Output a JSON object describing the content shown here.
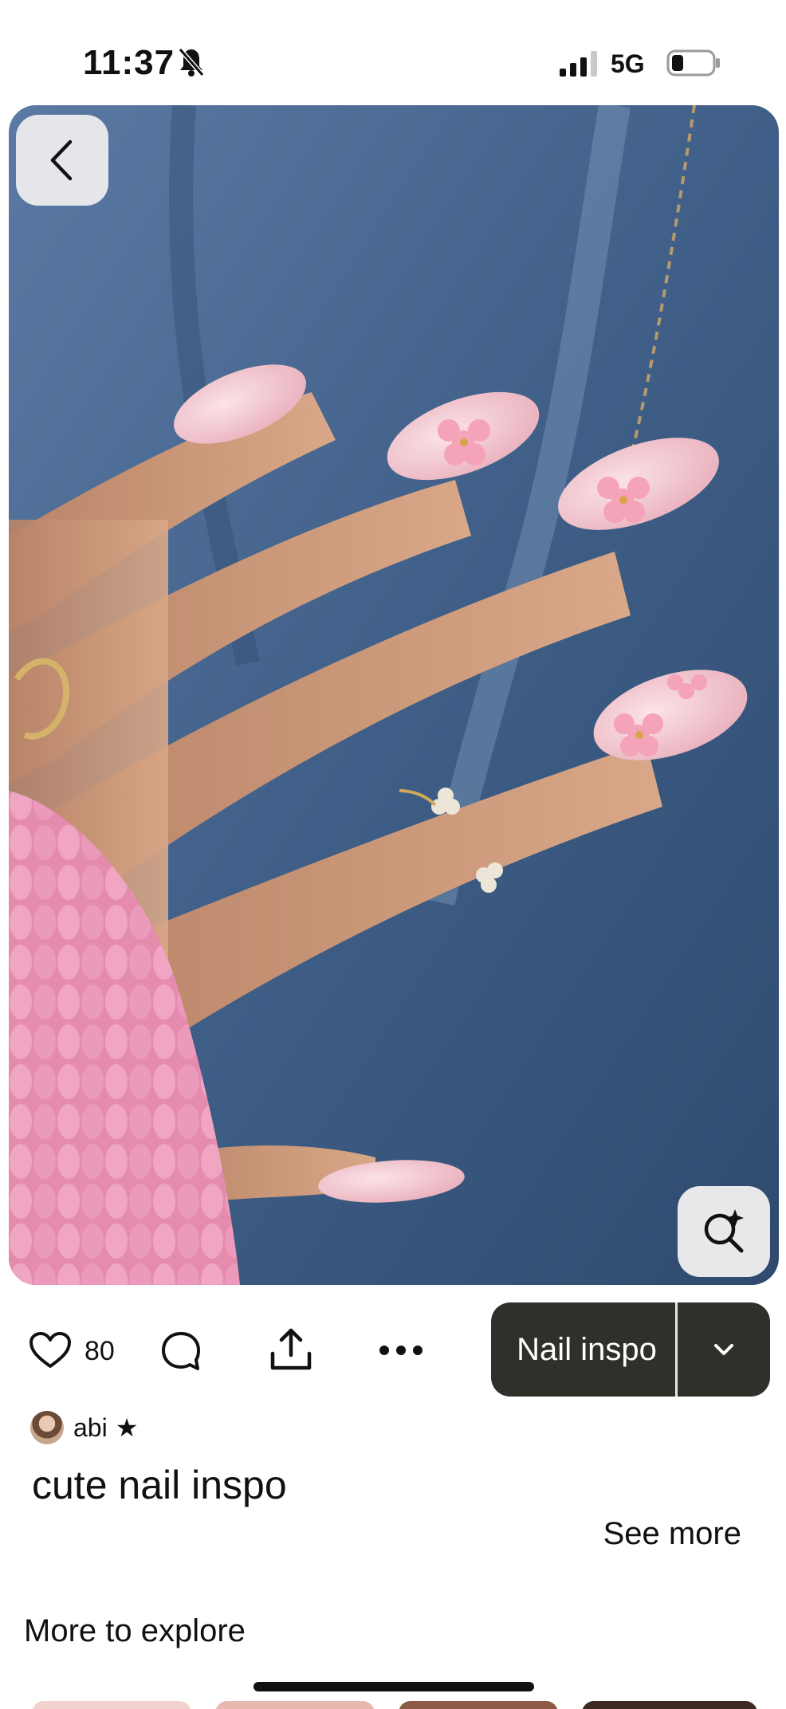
{
  "status_bar": {
    "time": "11:37",
    "network": "5G",
    "icons": [
      "bell-muted-icon",
      "signal-icon",
      "battery-icon"
    ]
  },
  "hero": {
    "icons": [
      "back-arrow-icon",
      "visual-search-icon"
    ]
  },
  "actions": {
    "like_count": "80",
    "board_label": "Nail inspo",
    "icons": [
      "heart-icon",
      "comment-icon",
      "share-icon",
      "more-icon",
      "chevron-down-icon"
    ]
  },
  "author": {
    "name": "abi",
    "badge": "★"
  },
  "pin": {
    "title": "cute nail inspo",
    "see_more": "See more"
  },
  "explore": {
    "heading": "More to explore"
  },
  "colors": {
    "save_group_bg": "#2e3029",
    "denim": "#4a6a93",
    "sweater_pink": "#e894b4",
    "nail_pink": "#f3c8d0"
  }
}
